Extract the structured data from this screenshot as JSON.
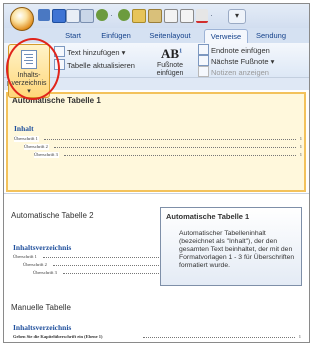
{
  "tabs": {
    "start": "Start",
    "insert": "Einfügen",
    "layout": "Seitenlayout",
    "references": "Verweise",
    "mailings": "Sendung"
  },
  "ribbon": {
    "toc_button_label_1": "Inhalts-",
    "toc_button_label_2": "verzeichnis",
    "toc_dropdown_arrow": "▾",
    "add_text": "Text hinzufügen",
    "update_table": "Tabelle aktualisieren",
    "footnote_icon": "AB",
    "footnote_icon_sup": "1",
    "footnote_label_1": "Fußnote",
    "footnote_label_2": "einfügen",
    "insert_endnote": "Endnote einfügen",
    "next_footnote": "Nächste Fußnote",
    "show_notes": "Notizen anzeigen",
    "dropdown_arrow": "▾",
    "qa_more": "▾",
    "group_label_partial": "Inhaltsv"
  },
  "gallery": {
    "sections": [
      {
        "header": "Integriert"
      }
    ],
    "items": [
      {
        "title": "Automatische Tabelle 1",
        "toc_heading": "Inhalt",
        "lines": [
          {
            "label": "Überschrift 1",
            "page": "1"
          },
          {
            "label": "Überschrift 2",
            "page": "1"
          },
          {
            "label": "Überschrift 3",
            "page": "1"
          }
        ]
      },
      {
        "title": "Automatische Tabelle 2",
        "toc_heading": "Inhaltsverzeichnis",
        "lines": [
          {
            "label": "Überschrift 1",
            "page": "1"
          },
          {
            "label": "Überschrift 2",
            "page": "1"
          },
          {
            "label": "Überschrift 3",
            "page": "1"
          }
        ]
      },
      {
        "title": "Manuelle Tabelle",
        "toc_heading": "Inhaltsverzeichnis",
        "lines": [
          {
            "label": "Geben Sie die Kapitelüberschrift ein (Ebene 1)",
            "page": "1"
          }
        ]
      }
    ]
  },
  "tooltip": {
    "title": "Automatische Tabelle 1",
    "body": "Automatischer Tabelleninhalt (bezeichnet als \"Inhalt\"), der den gesamten Text beinhaltet, der mit den Formatvorlagen 1 - 3 für Überschriften formatiert wurde."
  },
  "colors": {
    "accent": "#1f4f9c",
    "highlight_circle": "#e0241b",
    "selection": "#f3c25b"
  }
}
